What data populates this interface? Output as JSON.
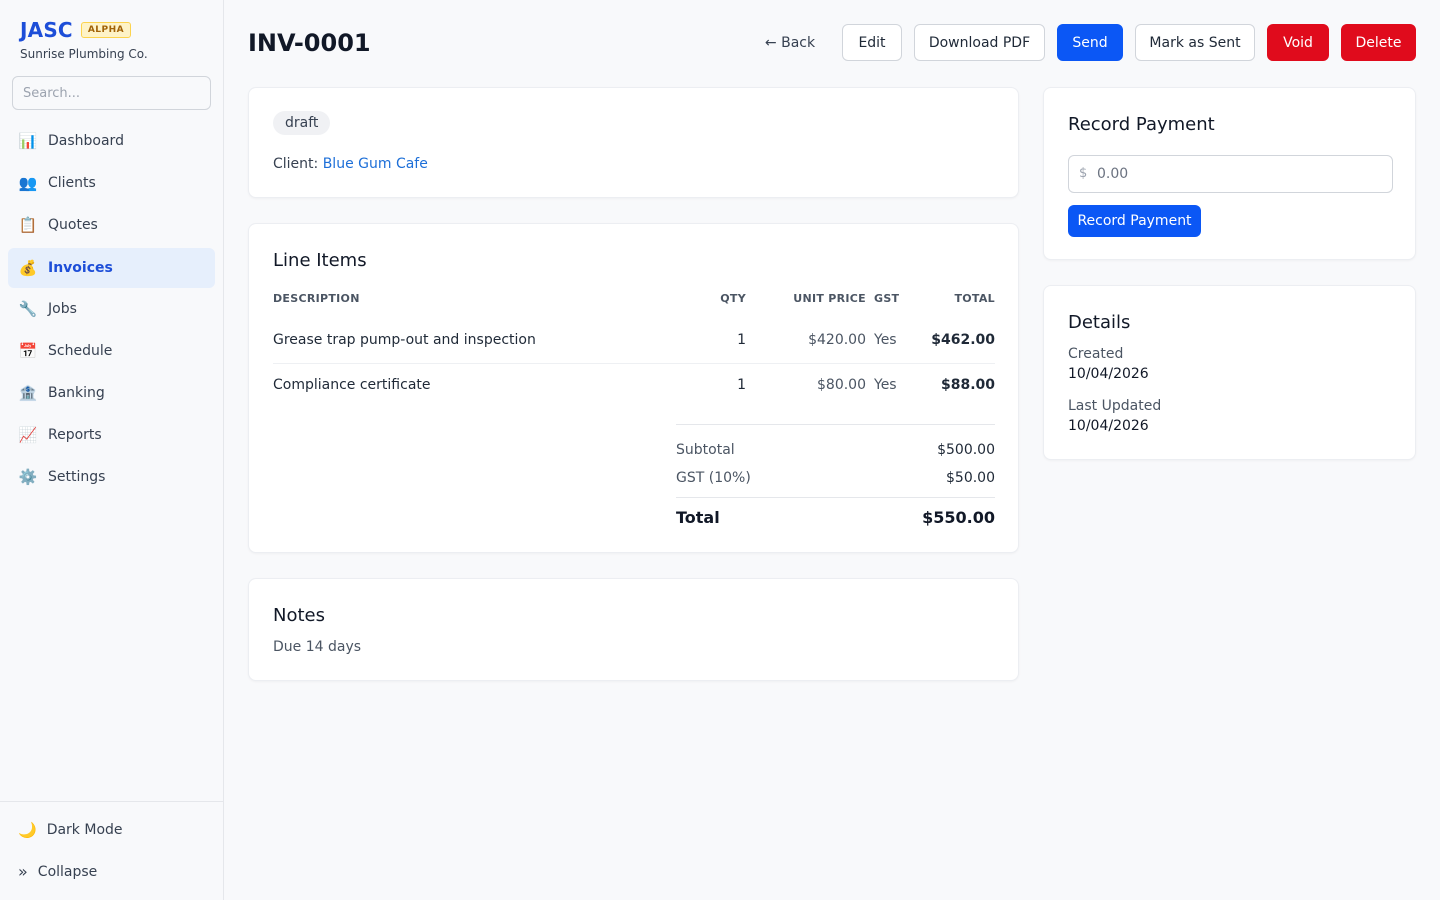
{
  "brand": {
    "name": "JASC",
    "badge": "ALPHA",
    "company": "Sunrise Plumbing Co."
  },
  "search": {
    "placeholder": "Search..."
  },
  "sidebar": {
    "items": [
      {
        "label": "Dashboard",
        "icon": "📊"
      },
      {
        "label": "Clients",
        "icon": "👥"
      },
      {
        "label": "Quotes",
        "icon": "📋"
      },
      {
        "label": "Invoices",
        "icon": "💰"
      },
      {
        "label": "Jobs",
        "icon": "🔧"
      },
      {
        "label": "Schedule",
        "icon": "📅"
      },
      {
        "label": "Banking",
        "icon": "🏦"
      },
      {
        "label": "Reports",
        "icon": "📈"
      },
      {
        "label": "Settings",
        "icon": "⚙️"
      }
    ],
    "active": "Invoices",
    "dark_mode": {
      "label": "Dark Mode",
      "icon": "🌙"
    },
    "collapse": {
      "label": "Collapse",
      "icon": "»"
    }
  },
  "header": {
    "title": "INV-0001",
    "back_label": "← Back",
    "edit_label": "Edit",
    "download_label": "Download PDF",
    "send_label": "Send",
    "mark_sent_label": "Mark as Sent",
    "void_label": "Void",
    "delete_label": "Delete"
  },
  "summary": {
    "status": "draft",
    "client_prefix": "Client:",
    "client_name": "Blue Gum Cafe"
  },
  "line_items": {
    "title": "Line Items",
    "columns": {
      "description": "DESCRIPTION",
      "qty": "QTY",
      "unit_price": "UNIT PRICE",
      "gst": "GST",
      "total": "TOTAL"
    },
    "rows": [
      {
        "description": "Grease trap pump-out and inspection",
        "qty": "1",
        "unit_price": "$420.00",
        "gst": "Yes",
        "total": "$462.00"
      },
      {
        "description": "Compliance certificate",
        "qty": "1",
        "unit_price": "$80.00",
        "gst": "Yes",
        "total": "$88.00"
      }
    ],
    "totals": {
      "subtotal_label": "Subtotal",
      "subtotal": "$500.00",
      "gst_label": "GST (10%)",
      "gst": "$50.00",
      "total_label": "Total",
      "total": "$550.00"
    }
  },
  "notes": {
    "title": "Notes",
    "text": "Due 14 days"
  },
  "payment": {
    "title": "Record Payment",
    "currency_symbol": "$",
    "amount_placeholder": "0.00",
    "button_label": "Record Payment"
  },
  "details": {
    "title": "Details",
    "created_label": "Created",
    "created": "10/04/2026",
    "updated_label": "Last Updated",
    "updated": "10/04/2026"
  },
  "colors": {
    "primary": "#0b57f5",
    "danger": "#e00b1c",
    "brand": "#1d4ed8",
    "link": "#1d6fd8",
    "active_nav_bg": "#e6effc"
  }
}
